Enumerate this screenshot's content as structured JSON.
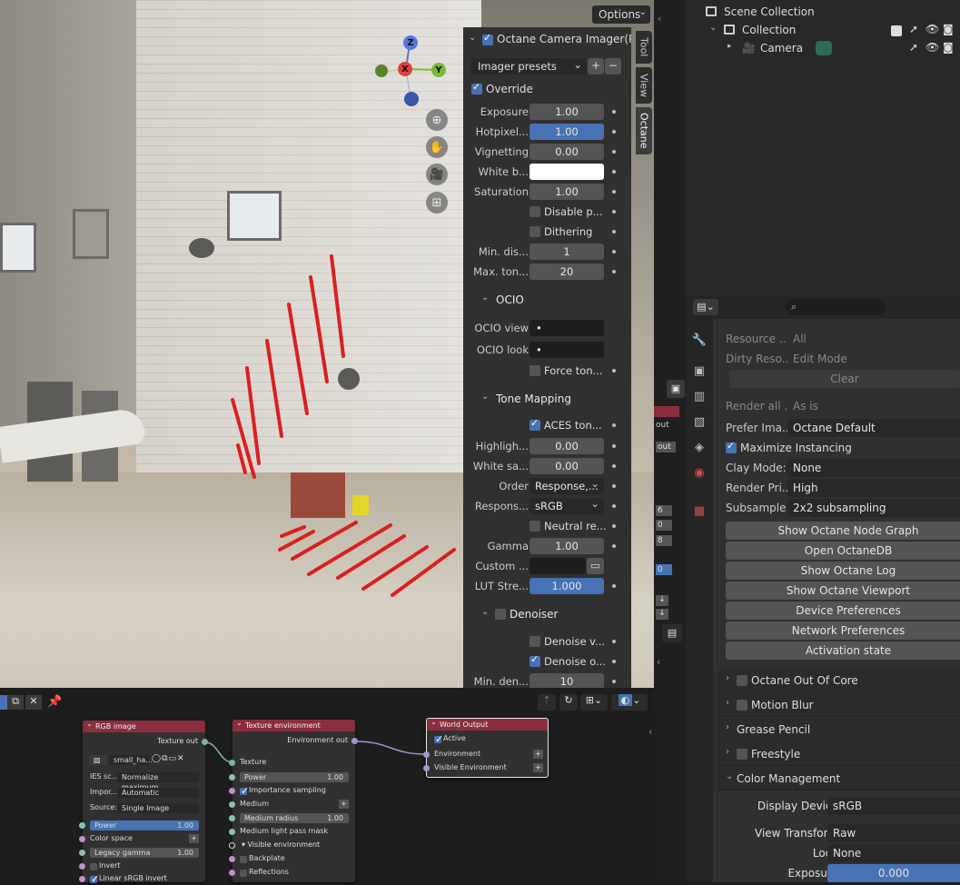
{
  "viewport": {
    "options_label": "Options",
    "gizmo": {
      "z": "Z",
      "x": "X",
      "y": "Y"
    },
    "tabs": [
      "Tool",
      "View",
      "Octane"
    ]
  },
  "npanel": {
    "title": "Octane Camera Imager(Previ",
    "imager_presets": "Imager presets",
    "override": "Override",
    "rows": {
      "exposure": {
        "label": "Exposure",
        "value": "1.00"
      },
      "hotpixel": {
        "label": "Hotpixel...",
        "value": "1.00"
      },
      "vignetting": {
        "label": "Vignetting",
        "value": "0.00"
      },
      "white_balance": {
        "label": "White b..."
      },
      "saturation": {
        "label": "Saturation",
        "value": "1.00"
      },
      "disable_p": "Disable p...",
      "dithering": "Dithering",
      "min_dis": {
        "label": "Min. dis...",
        "value": "1"
      },
      "max_ton": {
        "label": "Max. ton...",
        "value": "20"
      }
    },
    "ocio": {
      "title": "OCIO",
      "view_label": "OCIO view",
      "view_value": "•",
      "look_label": "OCIO look",
      "look_value": "•",
      "force": "Force ton..."
    },
    "tone_mapping": {
      "title": "Tone Mapping",
      "aces": "ACES ton...",
      "highlight": {
        "label": "Highligh...",
        "value": "0.00"
      },
      "white_sa": {
        "label": "White sa...",
        "value": "0.00"
      },
      "order": {
        "label": "Order",
        "value": "Response,..."
      },
      "response": {
        "label": "Respons...",
        "value": "sRGB"
      },
      "neutral": "Neutral re...",
      "gamma": {
        "label": "Gamma",
        "value": "1.00"
      },
      "custom": {
        "label": "Custom ..."
      },
      "lut": {
        "label": "LUT Stre...",
        "value": "1.000"
      }
    },
    "denoiser": {
      "title": "Denoiser",
      "denoise_v": "Denoise v...",
      "denoise_o": "Denoise o...",
      "min_den": {
        "label": "Min. den...",
        "value": "10"
      }
    },
    "annotation_mark": "?"
  },
  "outliner": {
    "scene_collection": "Scene Collection",
    "collection": "Collection",
    "camera": "Camera"
  },
  "properties": {
    "search_placeholder": "",
    "rows": [
      {
        "label": "Resource ...",
        "value": "All",
        "dim": true
      },
      {
        "label": "Dirty Reso...",
        "value": "Edit Mode",
        "dim": true
      }
    ],
    "clear": "Clear",
    "render_all": {
      "label": "Render all ...",
      "value": "As is"
    },
    "prefer": {
      "label": "Prefer Ima...",
      "value": "Octane Default"
    },
    "maximize": "Maximize Instancing",
    "clay": {
      "label": "Clay Mode:",
      "value": "None"
    },
    "render_pri": {
      "label": "Render Pri...",
      "value": "High"
    },
    "subsample": {
      "label": "Subsample...",
      "value": "2x2 subsampling"
    },
    "buttons": [
      "Show Octane Node Graph",
      "Open OctaneDB",
      "Show Octane Log",
      "Show Octane Viewport",
      "Device Preferences",
      "Network Preferences",
      "Activation state"
    ],
    "sections": [
      "Octane Out Of Core",
      "Motion Blur",
      "Grease Pencil",
      "Freestyle",
      "Color Management"
    ],
    "color_management": {
      "display_device": {
        "label": "Display Device",
        "value": "sRGB"
      },
      "view_transform": {
        "label": "View Transform",
        "value": "Raw"
      },
      "look": {
        "label": "Look",
        "value": "None"
      },
      "exposure": {
        "label": "Exposure",
        "value": "0.000"
      }
    }
  },
  "midstrip": {
    "labels": [
      "out",
      "out",
      "6",
      "0",
      "8",
      "0"
    ]
  },
  "nodes": {
    "rgb_image": {
      "title": "RGB image",
      "texture_out": "Texture out",
      "file": "small_ha...",
      "ies_label": "IES sc...",
      "ies_value": "Normalize maximum...",
      "import_label": "Impor...",
      "import_value": "Automatic",
      "source_label": "Source:",
      "source_value": "Single Image",
      "power_label": "Power",
      "power_value": "1.00",
      "color_space": "Color space",
      "legacy_label": "Legacy gamma",
      "legacy_value": "1.00",
      "invert": "Invert",
      "linear": "Linear sRGB invert"
    },
    "texture_env": {
      "title": "Texture environment",
      "env_out": "Environment out",
      "texture": "Texture",
      "power_label": "Power",
      "power_value": "1.00",
      "importance": "Importance sampling",
      "medium": "Medium",
      "medium_radius_label": "Medium radius",
      "medium_radius_value": "1.00",
      "medium_light": "Medium light pass mask",
      "visible_env": "Visible environment",
      "backplate": "Backplate",
      "reflections": "Reflections"
    },
    "world_output": {
      "title": "World Output",
      "active": "Active",
      "environment": "Environment",
      "visible_env": "Visible Environment"
    }
  },
  "colors": {
    "accent_blue": "#4772b3",
    "node_header": "#8a2e3f",
    "annotation_red": "#d92020"
  }
}
